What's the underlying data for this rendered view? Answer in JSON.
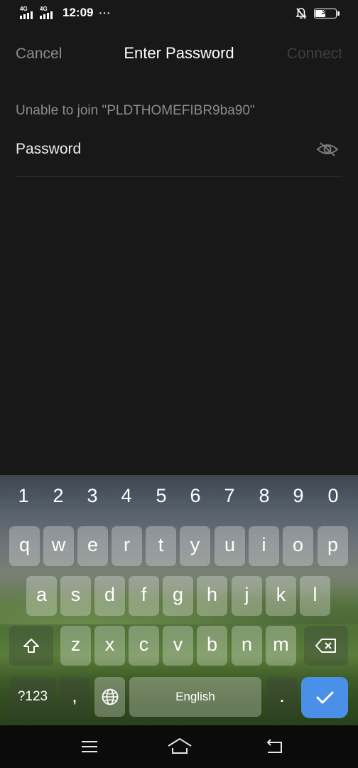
{
  "status_bar": {
    "network1": "4G",
    "network2": "4G",
    "time": "12:09",
    "more": "···",
    "battery": "39"
  },
  "header": {
    "cancel": "Cancel",
    "title": "Enter Password",
    "connect": "Connect"
  },
  "message": "Unable to join \"PLDTHOMEFIBR9ba90\"",
  "password_field": {
    "label": "Password",
    "visibility_icon": "eye-off-icon"
  },
  "keyboard": {
    "numbers": [
      "1",
      "2",
      "3",
      "4",
      "5",
      "6",
      "7",
      "8",
      "9",
      "0"
    ],
    "row1": [
      "q",
      "w",
      "e",
      "r",
      "t",
      "y",
      "u",
      "i",
      "o",
      "p"
    ],
    "row2": [
      "a",
      "s",
      "d",
      "f",
      "g",
      "h",
      "j",
      "k",
      "l"
    ],
    "row3": [
      "z",
      "x",
      "c",
      "v",
      "b",
      "n",
      "m"
    ],
    "symbols": "?123",
    "comma": ",",
    "space": "English",
    "period": ".",
    "shift_icon": "shift-icon",
    "backspace_icon": "backspace-icon",
    "globe_icon": "globe-icon",
    "enter_icon": "check-icon",
    "enter_color": "#4a90e8"
  },
  "nav_bar": {
    "menu_icon": "menu-icon",
    "home_icon": "home-icon",
    "back_icon": "back-icon"
  }
}
